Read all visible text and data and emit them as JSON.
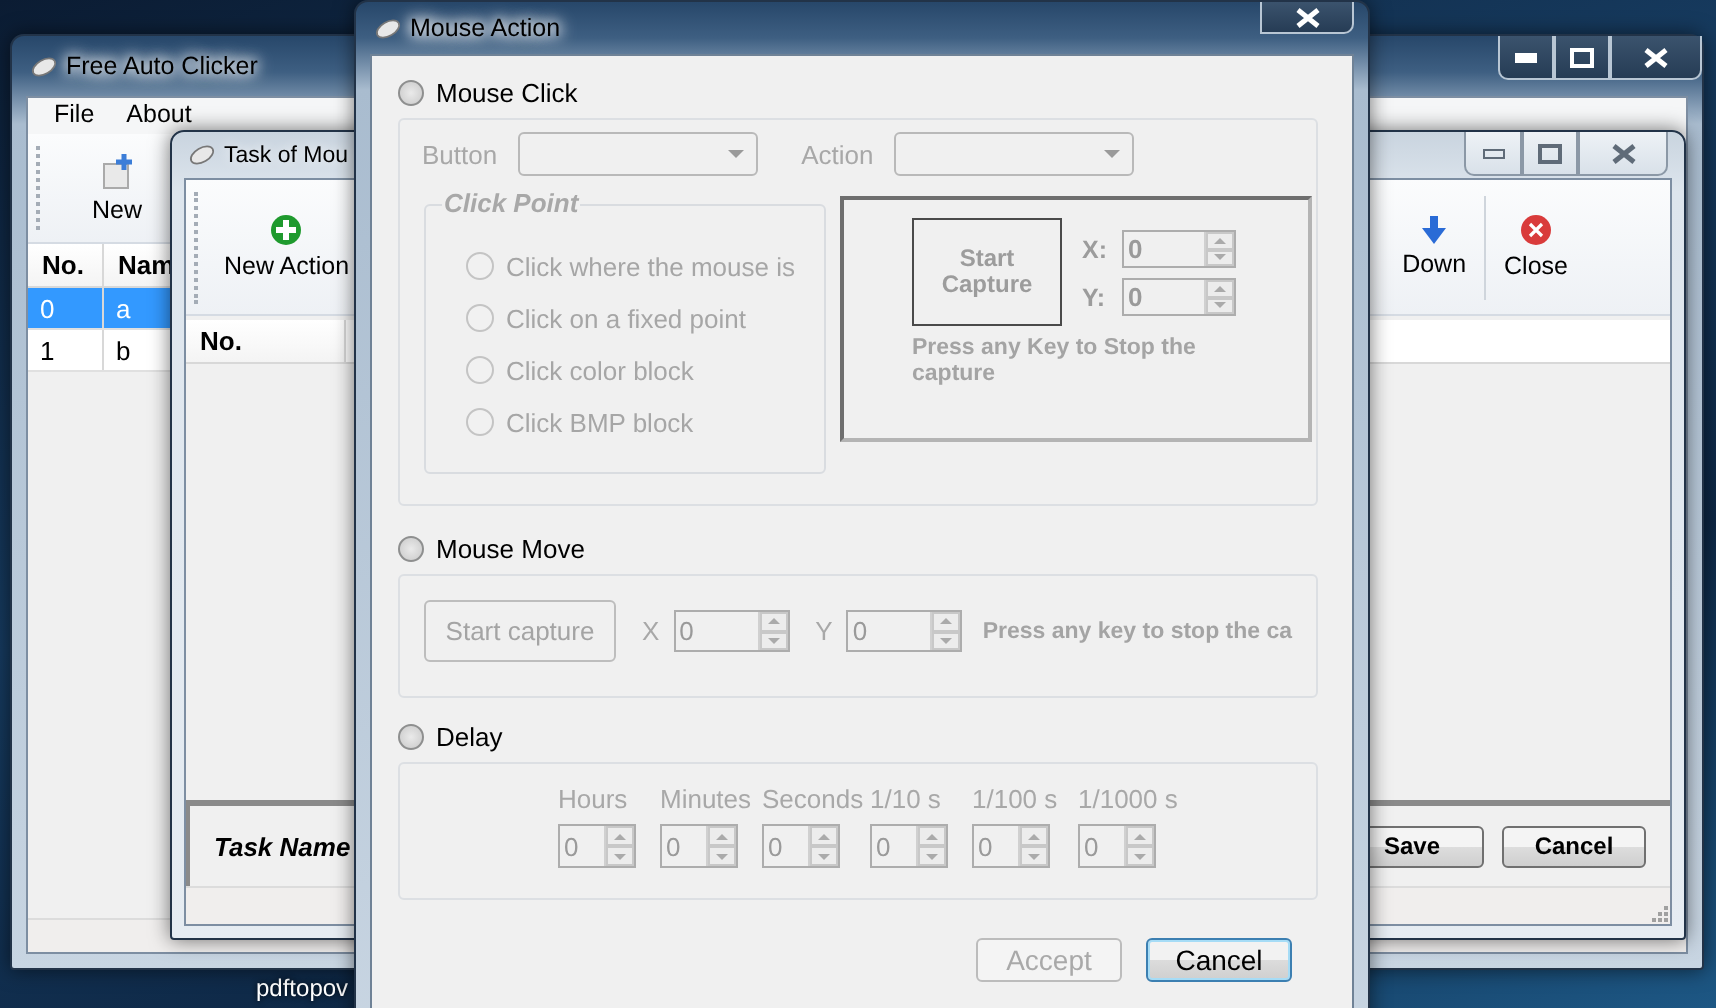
{
  "desktop": {
    "icon_label": "pdftopov"
  },
  "main_window": {
    "title": "Free Auto Clicker",
    "active": true,
    "menu": [
      "File",
      "About"
    ],
    "toolbar": [
      {
        "label": "New",
        "kind": "new"
      }
    ],
    "table": {
      "columns": [
        "No.",
        "Nam"
      ],
      "rows": [
        {
          "cells": [
            "0",
            "a"
          ],
          "selected": true
        },
        {
          "cells": [
            "1",
            "b"
          ],
          "selected": false
        }
      ]
    }
  },
  "task_window": {
    "title": "Task of Mou",
    "active": false,
    "toolbar": [
      {
        "label": "New Action",
        "kind": "add"
      },
      {
        "label": "Down",
        "kind": "down"
      },
      {
        "label": "Close",
        "kind": "close"
      }
    ],
    "table": {
      "columns": [
        "No."
      ]
    },
    "task_name_label": "Task Name",
    "buttons": [
      "Save",
      "Cancel"
    ]
  },
  "dialog": {
    "title": "Mouse Action",
    "active": true,
    "mouse_click": {
      "label": "Mouse Click",
      "selected": false,
      "disabled": true,
      "button_label": "Button",
      "action_label": "Action",
      "click_point": {
        "title": "Click Point",
        "options": [
          {
            "label": "Click where the mouse is",
            "selected": false
          },
          {
            "label": "Click on a fixed point",
            "selected": false
          },
          {
            "label": "Click color block",
            "selected": false
          },
          {
            "label": "Click BMP block",
            "selected": false
          }
        ]
      },
      "capture": {
        "button": "Start Capture",
        "x_label": "X:",
        "x_value": "0",
        "y_label": "Y:",
        "y_value": "0",
        "hint": "Press any Key to Stop the capture"
      }
    },
    "mouse_move": {
      "label": "Mouse Move",
      "selected": false,
      "disabled": true,
      "button": "Start capture",
      "x_label": "X",
      "x_value": "0",
      "y_label": "Y",
      "y_value": "0",
      "hint": "Press any key to stop the ca"
    },
    "delay": {
      "label": "Delay",
      "selected": false,
      "disabled": true,
      "fields": [
        {
          "label": "Hours",
          "value": "0"
        },
        {
          "label": "Minutes",
          "value": "0"
        },
        {
          "label": "Seconds",
          "value": "0"
        },
        {
          "label": "1/10 s",
          "value": "0"
        },
        {
          "label": "1/100 s",
          "value": "0"
        },
        {
          "label": "1/1000 s",
          "value": "0"
        }
      ]
    },
    "buttons": [
      {
        "label": "Accept",
        "disabled": true,
        "focused": false
      },
      {
        "label": "Cancel",
        "disabled": false,
        "focused": true
      }
    ]
  }
}
